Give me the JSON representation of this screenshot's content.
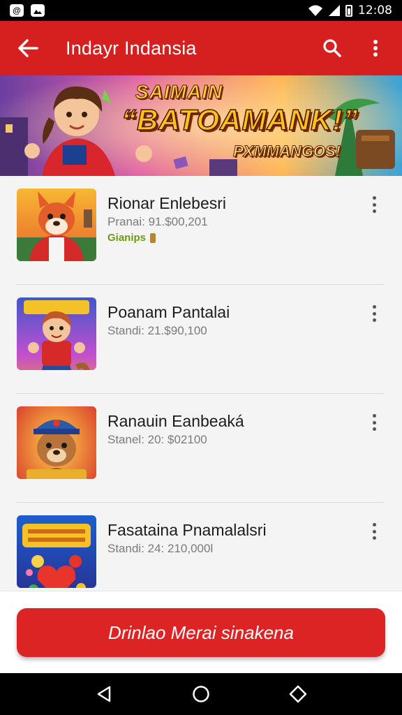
{
  "status_bar": {
    "time": "12:08",
    "icons": [
      "notification-icon",
      "image-icon",
      "wifi-icon",
      "signal-icon",
      "battery-icon"
    ]
  },
  "app_bar": {
    "title": "Indayr Indansia",
    "back_icon": "arrow-left-icon",
    "search_icon": "search-icon",
    "more_icon": "more-vertical-icon",
    "color": "#d61f1f"
  },
  "banner": {
    "line1": "SAIMAIN",
    "line2": "“BATOAMANK!”",
    "line3": "PXMMANGOS!"
  },
  "list": {
    "items": [
      {
        "name": "Rionar Enlebesri",
        "stat": "Pranai: 91.$00,201",
        "badge": "Gianips"
      },
      {
        "name": "Poanam Pantalai",
        "stat": "Standi: 21.$90,100"
      },
      {
        "name": "Ranauin Eanbeaká",
        "stat": "Stanel: 20: $02100"
      },
      {
        "name": "Fasataina Pnamalalsri",
        "stat": "Standi: 24: 210,000l"
      }
    ]
  },
  "cta": {
    "label": "Drinlao Merai sinakena",
    "color": "#dd2424"
  },
  "nav_bar": {
    "icons": [
      "back-triangle-icon",
      "home-circle-icon",
      "recents-diamond-icon"
    ]
  }
}
